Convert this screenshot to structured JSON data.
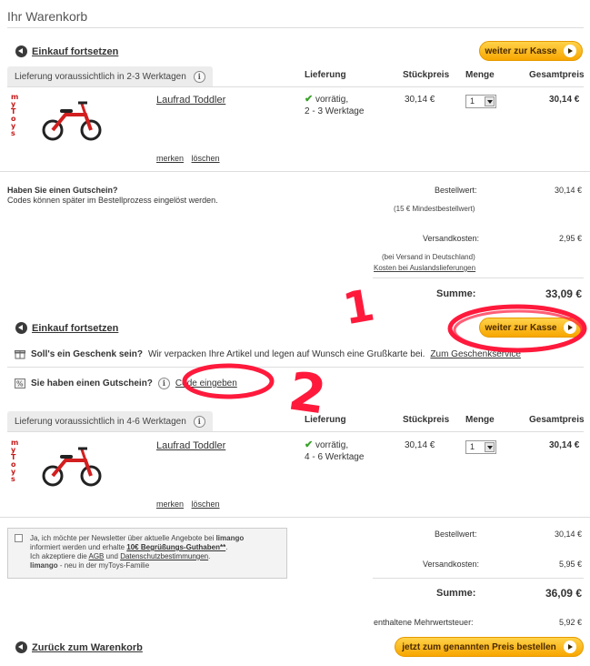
{
  "header": {
    "title": "Ihr Warenkorb"
  },
  "nav": {
    "continue_shopping": "Einkauf fortsetzen",
    "checkout": "weiter zur Kasse",
    "back_to_cart": "Zurück zum Warenkorb",
    "order_button": "jetzt zum genannten Preis bestellen"
  },
  "columns": {
    "delivery": "Lieferung",
    "unit_price": "Stückpreis",
    "quantity": "Menge",
    "total_price": "Gesamtpreis"
  },
  "section1": {
    "tab": "Lieferung voraussichtlich in 2-3 Werktagen",
    "item": {
      "name": "Laufrad Toddler",
      "stock": "vorrätig,",
      "days": "2 - 3 Werktage",
      "unit_price": "30,14 €",
      "qty": "1",
      "total": "30,14 €",
      "remember": "merken",
      "delete": "löschen",
      "brand": "myToys"
    }
  },
  "voucher": {
    "title": "Haben Sie einen Gutschein?",
    "text": "Codes können später im Bestellprozess eingelöst werden."
  },
  "summary1": {
    "order_value_label": "Bestellwert:",
    "order_value": "30,14 €",
    "min_order": "(15 € Mindestbestellwert)",
    "shipping_label": "Versandkosten:",
    "shipping": "2,95 €",
    "shipping_note": "(bei Versand in Deutschland)",
    "foreign_link": "Kosten bei Auslandslieferungen",
    "sum_label": "Summe:",
    "sum": "33,09 €"
  },
  "gift": {
    "title": "Soll's ein Geschenk sein?",
    "text": "Wir verpacken Ihre Artikel und legen auf Wunsch eine Grußkarte bei.",
    "link": "Zum Geschenkservice"
  },
  "voucher2": {
    "title": "Sie haben einen Gutschein?",
    "link": "Code eingeben"
  },
  "section2": {
    "tab": "Lieferung voraussichtlich in 4-6 Werktagen",
    "item": {
      "name": "Laufrad Toddler",
      "stock": "vorrätig,",
      "days": "4 - 6 Werktage",
      "unit_price": "30,14 €",
      "qty": "1",
      "total": "30,14 €",
      "remember": "merken",
      "delete": "löschen",
      "brand": "myToys"
    }
  },
  "newsletter": {
    "line1a": "Ja, ich möchte per Newsletter über aktuelle Angebote bei ",
    "line1b": "limango",
    "line2a": "informiert werden und erhalte ",
    "line2b": "10€ Begrüßungs-Guthaben**",
    "line3a": "Ich akzeptiere die ",
    "agb": "AGB",
    "und": " und ",
    "privacy": "Datenschutzbestimmungen",
    "line4a": "limango",
    "line4b": " - neu in der myToys-Familie"
  },
  "summary2": {
    "order_value_label": "Bestellwert:",
    "order_value": "30,14 €",
    "shipping_label": "Versandkosten:",
    "shipping": "5,95 €",
    "sum_label": "Summe:",
    "sum": "36,09 €",
    "vat_label": "enthaltene Mehrwertsteuer:",
    "vat": "5,92 €"
  },
  "annotations": {
    "one": "1",
    "two": "2"
  },
  "colors": {
    "accent": "#f7a600",
    "annotation": "#ff1a3c",
    "instock": "#3aa12b"
  }
}
